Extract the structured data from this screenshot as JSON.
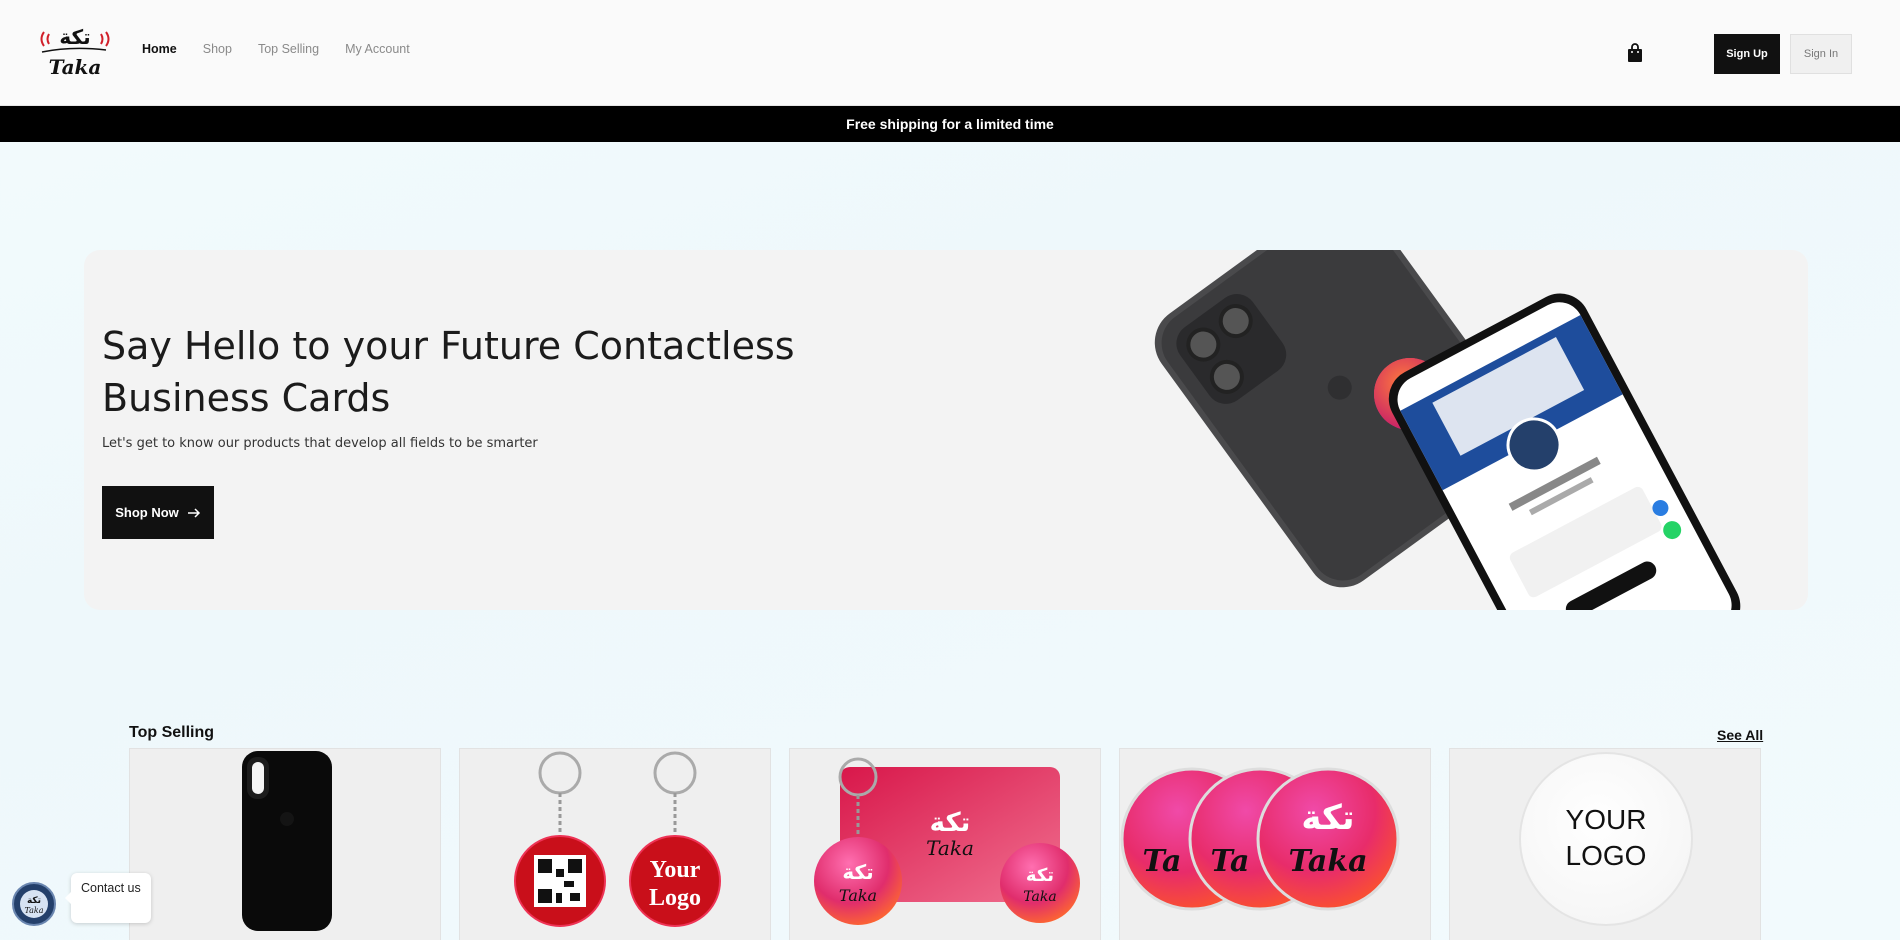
{
  "brand": {
    "logo_arabic": "تكة",
    "logo_latin": "Taka"
  },
  "nav": {
    "items": [
      {
        "label": "Home",
        "active": true
      },
      {
        "label": "Shop"
      },
      {
        "label": "Top Selling"
      },
      {
        "label": "My Account"
      }
    ]
  },
  "header": {
    "signup_label": "Sign Up",
    "signin_label": "Sign In",
    "cart_icon": "shopping-bag-icon"
  },
  "announcement": {
    "text": "Free shipping for a limited time"
  },
  "hero": {
    "title": "Say Hello to your Future Contactless Business Cards",
    "subtitle": "Let's get to know our products that develop all fields to be smarter",
    "cta_label": "Shop Now",
    "cta_icon": "arrow-right-icon"
  },
  "top_selling": {
    "title": "Top Selling",
    "see_all_label": "See All",
    "products": [
      {
        "image": "black-phone-case"
      },
      {
        "image": "red-keychains-qr-and-your-logo",
        "printed_text": "Your Logo"
      },
      {
        "image": "taka-card-with-keychain"
      },
      {
        "image": "three-taka-round-tags"
      },
      {
        "image": "white-round-tag-your-logo",
        "printed_text": "YOUR LOGO"
      }
    ]
  },
  "contact": {
    "label": "Contact us"
  },
  "colors": {
    "accent": "#111111",
    "announce_bg": "#000000",
    "brand_red": "#d1202a",
    "brand_pink": "#e0308a"
  }
}
